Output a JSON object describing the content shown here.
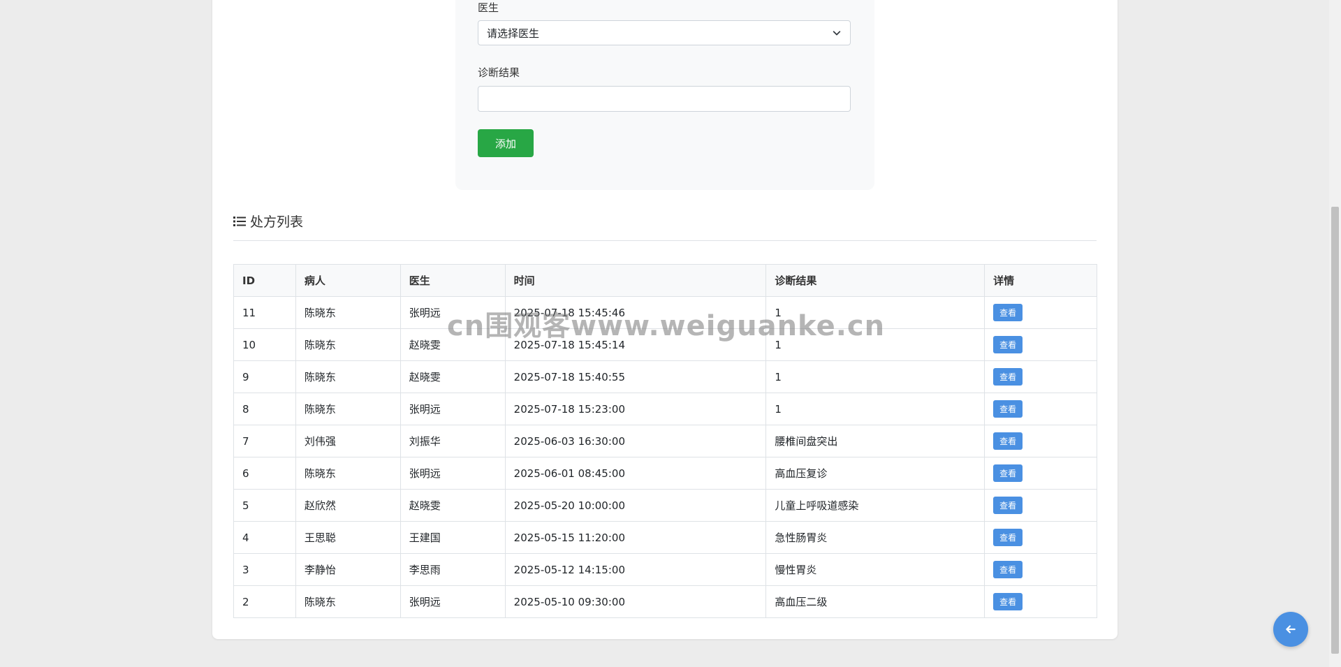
{
  "form": {
    "doctor_label": "医生",
    "doctor_select_value": "请选择医生",
    "diagnosis_label": "诊断结果",
    "diagnosis_value": "",
    "add_button": "添加"
  },
  "list": {
    "title": "处方列表",
    "columns": [
      "ID",
      "病人",
      "医生",
      "时间",
      "诊断结果",
      "详情"
    ],
    "view_label": "查看",
    "rows": [
      {
        "id": "11",
        "patient": "陈晓东",
        "doctor": "张明远",
        "time": "2025-07-18 15:45:46",
        "diagnosis": "1"
      },
      {
        "id": "10",
        "patient": "陈晓东",
        "doctor": "赵晓雯",
        "time": "2025-07-18 15:45:14",
        "diagnosis": "1"
      },
      {
        "id": "9",
        "patient": "陈晓东",
        "doctor": "赵晓雯",
        "time": "2025-07-18 15:40:55",
        "diagnosis": "1"
      },
      {
        "id": "8",
        "patient": "陈晓东",
        "doctor": "张明远",
        "time": "2025-07-18 15:23:00",
        "diagnosis": "1"
      },
      {
        "id": "7",
        "patient": "刘伟强",
        "doctor": "刘振华",
        "time": "2025-06-03 16:30:00",
        "diagnosis": "腰椎间盘突出"
      },
      {
        "id": "6",
        "patient": "陈晓东",
        "doctor": "张明远",
        "time": "2025-06-01 08:45:00",
        "diagnosis": "高血压复诊"
      },
      {
        "id": "5",
        "patient": "赵欣然",
        "doctor": "赵晓雯",
        "time": "2025-05-20 10:00:00",
        "diagnosis": "儿童上呼吸道感染"
      },
      {
        "id": "4",
        "patient": "王思聪",
        "doctor": "王建国",
        "time": "2025-05-15 11:20:00",
        "diagnosis": "急性肠胃炎"
      },
      {
        "id": "3",
        "patient": "李静怡",
        "doctor": "李思雨",
        "time": "2025-05-12 14:15:00",
        "diagnosis": "慢性胃炎"
      },
      {
        "id": "2",
        "patient": "陈晓东",
        "doctor": "张明远",
        "time": "2025-05-10 09:30:00",
        "diagnosis": "高血压二级"
      }
    ]
  },
  "watermark": "cn围观客www.weiguanke.cn",
  "colors": {
    "add_button": "#28a745",
    "view_button": "#4a90e2",
    "back_button": "#4a90e2"
  },
  "icons": {
    "section": "list-icon",
    "select": "chevron-down-icon",
    "back": "arrow-left-icon"
  }
}
